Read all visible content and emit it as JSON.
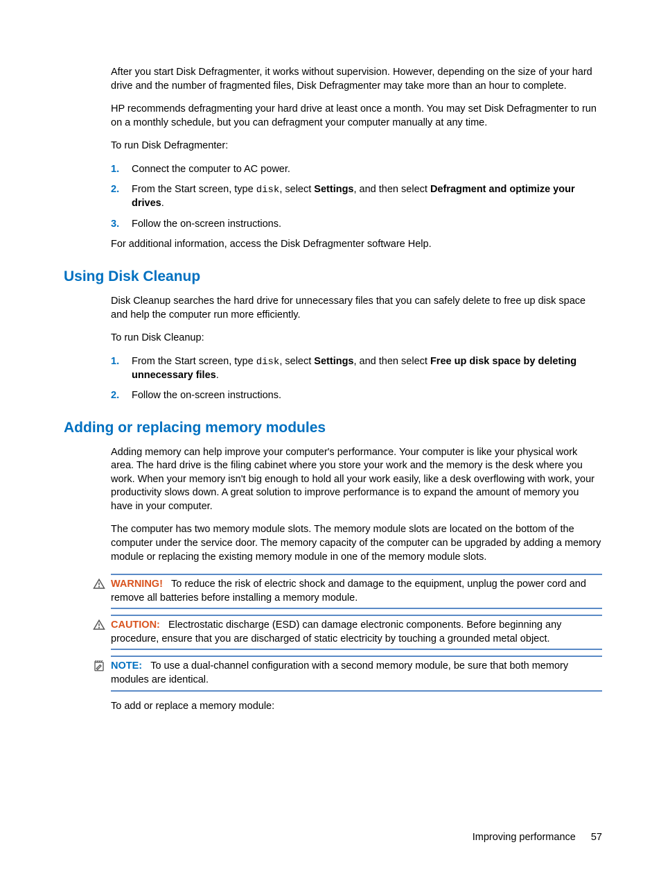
{
  "intro": {
    "p1": "After you start Disk Defragmenter, it works without supervision. However, depending on the size of your hard drive and the number of fragmented files, Disk Defragmenter may take more than an hour to complete.",
    "p2": "HP recommends defragmenting your hard drive at least once a month. You may set Disk Defragmenter to run on a monthly schedule, but you can defragment your computer manually at any time.",
    "p3": "To run Disk Defragmenter:",
    "steps": {
      "s1": {
        "num": "1.",
        "text": "Connect the computer to AC power."
      },
      "s2": {
        "num": "2.",
        "pre": "From the Start screen, type ",
        "code": "disk",
        "mid": ", select ",
        "b1": "Settings",
        "mid2": ", and then select ",
        "b2": "Defragment and optimize your drives",
        "tail": "."
      },
      "s3": {
        "num": "3.",
        "text": "Follow the on-screen instructions."
      }
    },
    "p4": "For additional information, access the Disk Defragmenter software Help."
  },
  "cleanup": {
    "heading": "Using Disk Cleanup",
    "p1": "Disk Cleanup searches the hard drive for unnecessary files that you can safely delete to free up disk space and help the computer run more efficiently.",
    "p2": "To run Disk Cleanup:",
    "steps": {
      "s1": {
        "num": "1.",
        "pre": "From the Start screen, type ",
        "code": "disk",
        "mid": ", select ",
        "b1": "Settings",
        "mid2": ", and then select ",
        "b2": "Free up disk space by deleting unnecessary files",
        "tail": "."
      },
      "s2": {
        "num": "2.",
        "text": "Follow the on-screen instructions."
      }
    }
  },
  "memory": {
    "heading": "Adding or replacing memory modules",
    "p1": "Adding memory can help improve your computer's performance. Your computer is like your physical work area. The hard drive is the filing cabinet where you store your work and the memory is the desk where you work. When your memory isn't big enough to hold all your work easily, like a desk overflowing with work, your productivity slows down. A great solution to improve performance is to expand the amount of memory you have in your computer.",
    "p2": "The computer has two memory module slots. The memory module slots are located on the bottom of the computer under the service door. The memory capacity of the computer can be upgraded by adding a memory module or replacing the existing memory module in one of the memory module slots.",
    "warning": {
      "label": "WARNING!",
      "text": "To reduce the risk of electric shock and damage to the equipment, unplug the power cord and remove all batteries before installing a memory module."
    },
    "caution": {
      "label": "CAUTION:",
      "text": "Electrostatic discharge (ESD) can damage electronic components. Before beginning any procedure, ensure that you are discharged of static electricity by touching a grounded metal object."
    },
    "note": {
      "label": "NOTE:",
      "text": "To use a dual-channel configuration with a second memory module, be sure that both memory modules are identical."
    },
    "p3": "To add or replace a memory module:"
  },
  "footer": {
    "text": "Improving performance",
    "page": "57"
  }
}
